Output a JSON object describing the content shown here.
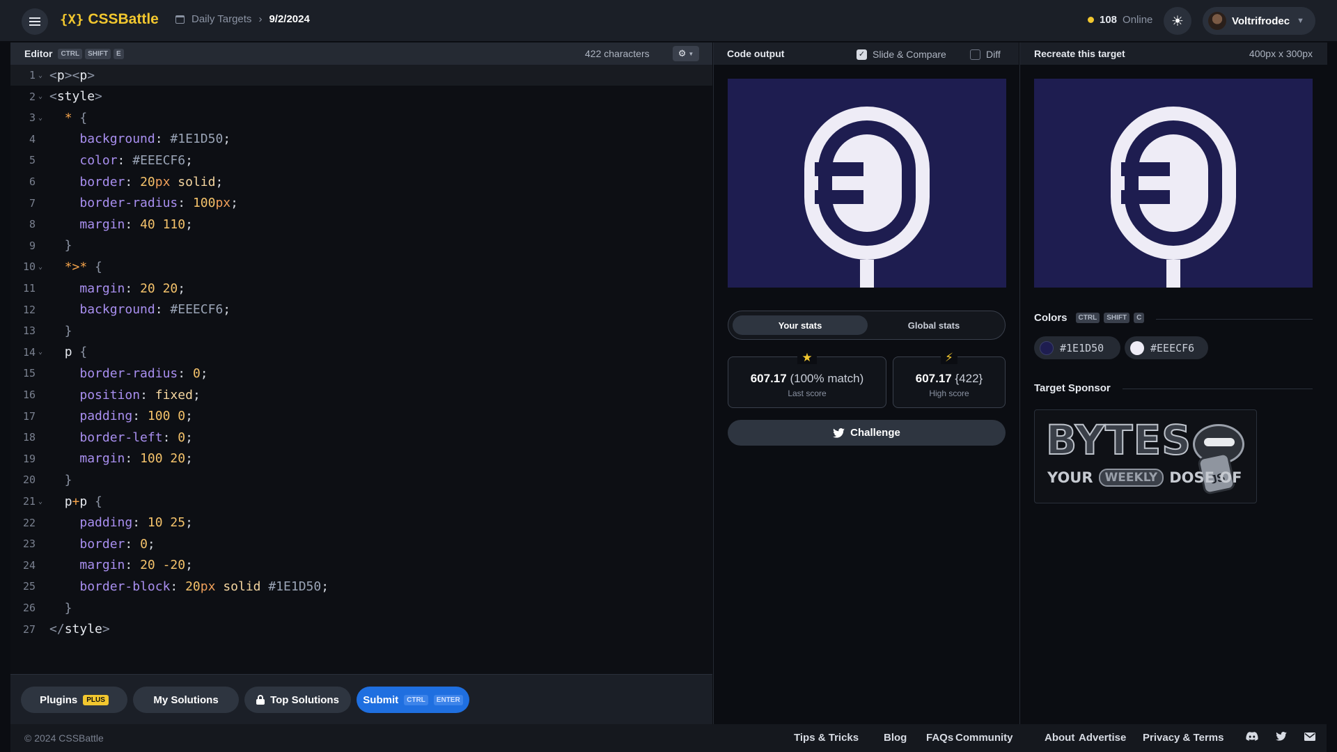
{
  "header": {
    "logo_mark": "{X}",
    "logo_text": "CSSBattle",
    "breadcrumb": {
      "section": "Daily Targets",
      "current": "9/2/2024"
    },
    "online_count": "108",
    "online_label": "Online",
    "username": "Voltrifrodec"
  },
  "editor": {
    "title": "Editor",
    "shortcut": [
      "CTRL",
      "SHIFT",
      "E"
    ],
    "char_count": "422 characters",
    "lines": [
      {
        "n": "1",
        "fold": true,
        "tokens": [
          [
            "t-tag",
            "<"
          ],
          [
            "t-name",
            "p"
          ],
          [
            "t-tag",
            "><"
          ],
          [
            "t-name",
            "p"
          ],
          [
            "t-tag",
            ">"
          ]
        ]
      },
      {
        "n": "2",
        "fold": true,
        "tokens": [
          [
            "t-tag",
            "<"
          ],
          [
            "t-name",
            "style"
          ],
          [
            "t-tag",
            ">"
          ]
        ]
      },
      {
        "n": "3",
        "fold": true,
        "tokens": [
          [
            "t-pl",
            "  "
          ],
          [
            "t-sel",
            "*"
          ],
          [
            "t-brace",
            " {"
          ]
        ]
      },
      {
        "n": "4",
        "fold": false,
        "tokens": [
          [
            "t-pl",
            "    "
          ],
          [
            "t-prop",
            "background"
          ],
          [
            "t-pl",
            ": "
          ],
          [
            "t-hex",
            "#1E1D50"
          ],
          [
            "t-pl",
            ";"
          ]
        ]
      },
      {
        "n": "5",
        "fold": false,
        "tokens": [
          [
            "t-pl",
            "    "
          ],
          [
            "t-prop",
            "color"
          ],
          [
            "t-pl",
            ": "
          ],
          [
            "t-hex",
            "#EEECF6"
          ],
          [
            "t-pl",
            ";"
          ]
        ]
      },
      {
        "n": "6",
        "fold": false,
        "tokens": [
          [
            "t-pl",
            "    "
          ],
          [
            "t-prop",
            "border"
          ],
          [
            "t-pl",
            ": "
          ],
          [
            "t-num",
            "20"
          ],
          [
            "t-unit",
            "px"
          ],
          [
            "t-pl",
            " "
          ],
          [
            "t-kw",
            "solid"
          ],
          [
            "t-pl",
            ";"
          ]
        ]
      },
      {
        "n": "7",
        "fold": false,
        "tokens": [
          [
            "t-pl",
            "    "
          ],
          [
            "t-prop",
            "border-radius"
          ],
          [
            "t-pl",
            ": "
          ],
          [
            "t-num",
            "100"
          ],
          [
            "t-unit",
            "px"
          ],
          [
            "t-pl",
            ";"
          ]
        ]
      },
      {
        "n": "8",
        "fold": false,
        "tokens": [
          [
            "t-pl",
            "    "
          ],
          [
            "t-prop",
            "margin"
          ],
          [
            "t-pl",
            ": "
          ],
          [
            "t-num",
            "40 110"
          ],
          [
            "t-pl",
            ";"
          ]
        ]
      },
      {
        "n": "9",
        "fold": false,
        "tokens": [
          [
            "t-brace",
            "  }"
          ]
        ]
      },
      {
        "n": "10",
        "fold": true,
        "tokens": [
          [
            "t-pl",
            "  "
          ],
          [
            "t-sel",
            "*>*"
          ],
          [
            "t-brace",
            " {"
          ]
        ]
      },
      {
        "n": "11",
        "fold": false,
        "tokens": [
          [
            "t-pl",
            "    "
          ],
          [
            "t-prop",
            "margin"
          ],
          [
            "t-pl",
            ": "
          ],
          [
            "t-num",
            "20 20"
          ],
          [
            "t-pl",
            ";"
          ]
        ]
      },
      {
        "n": "12",
        "fold": false,
        "tokens": [
          [
            "t-pl",
            "    "
          ],
          [
            "t-prop",
            "background"
          ],
          [
            "t-pl",
            ": "
          ],
          [
            "t-hex",
            "#EEECF6"
          ],
          [
            "t-pl",
            ";"
          ]
        ]
      },
      {
        "n": "13",
        "fold": false,
        "tokens": [
          [
            "t-brace",
            "  }"
          ]
        ]
      },
      {
        "n": "14",
        "fold": true,
        "tokens": [
          [
            "t-pl",
            "  "
          ],
          [
            "t-name",
            "p"
          ],
          [
            "t-brace",
            " {"
          ]
        ]
      },
      {
        "n": "15",
        "fold": false,
        "tokens": [
          [
            "t-pl",
            "    "
          ],
          [
            "t-prop",
            "border-radius"
          ],
          [
            "t-pl",
            ": "
          ],
          [
            "t-num",
            "0"
          ],
          [
            "t-pl",
            ";"
          ]
        ]
      },
      {
        "n": "16",
        "fold": false,
        "tokens": [
          [
            "t-pl",
            "    "
          ],
          [
            "t-prop",
            "position"
          ],
          [
            "t-pl",
            ": "
          ],
          [
            "t-kw",
            "fixed"
          ],
          [
            "t-pl",
            ";"
          ]
        ]
      },
      {
        "n": "17",
        "fold": false,
        "tokens": [
          [
            "t-pl",
            "    "
          ],
          [
            "t-prop",
            "padding"
          ],
          [
            "t-pl",
            ": "
          ],
          [
            "t-num",
            "100 0"
          ],
          [
            "t-pl",
            ";"
          ]
        ]
      },
      {
        "n": "18",
        "fold": false,
        "tokens": [
          [
            "t-pl",
            "    "
          ],
          [
            "t-prop",
            "border-left"
          ],
          [
            "t-pl",
            ": "
          ],
          [
            "t-num",
            "0"
          ],
          [
            "t-pl",
            ";"
          ]
        ]
      },
      {
        "n": "19",
        "fold": false,
        "tokens": [
          [
            "t-pl",
            "    "
          ],
          [
            "t-prop",
            "margin"
          ],
          [
            "t-pl",
            ": "
          ],
          [
            "t-num",
            "100 20"
          ],
          [
            "t-pl",
            ";"
          ]
        ]
      },
      {
        "n": "20",
        "fold": false,
        "tokens": [
          [
            "t-brace",
            "  }"
          ]
        ]
      },
      {
        "n": "21",
        "fold": true,
        "tokens": [
          [
            "t-pl",
            "  "
          ],
          [
            "t-name",
            "p"
          ],
          [
            "t-sel",
            "+"
          ],
          [
            "t-name",
            "p"
          ],
          [
            "t-brace",
            " {"
          ]
        ]
      },
      {
        "n": "22",
        "fold": false,
        "tokens": [
          [
            "t-pl",
            "    "
          ],
          [
            "t-prop",
            "padding"
          ],
          [
            "t-pl",
            ": "
          ],
          [
            "t-num",
            "10 25"
          ],
          [
            "t-pl",
            ";"
          ]
        ]
      },
      {
        "n": "23",
        "fold": false,
        "tokens": [
          [
            "t-pl",
            "    "
          ],
          [
            "t-prop",
            "border"
          ],
          [
            "t-pl",
            ": "
          ],
          [
            "t-num",
            "0"
          ],
          [
            "t-pl",
            ";"
          ]
        ]
      },
      {
        "n": "24",
        "fold": false,
        "tokens": [
          [
            "t-pl",
            "    "
          ],
          [
            "t-prop",
            "margin"
          ],
          [
            "t-pl",
            ": "
          ],
          [
            "t-num",
            "20 -20"
          ],
          [
            "t-pl",
            ";"
          ]
        ]
      },
      {
        "n": "25",
        "fold": false,
        "tokens": [
          [
            "t-pl",
            "    "
          ],
          [
            "t-prop",
            "border-block"
          ],
          [
            "t-pl",
            ": "
          ],
          [
            "t-num",
            "20"
          ],
          [
            "t-unit",
            "px"
          ],
          [
            "t-pl",
            " "
          ],
          [
            "t-kw",
            "solid"
          ],
          [
            "t-pl",
            " "
          ],
          [
            "t-hex",
            "#1E1D50"
          ],
          [
            "t-pl",
            ";"
          ]
        ]
      },
      {
        "n": "26",
        "fold": false,
        "tokens": [
          [
            "t-brace",
            "  }"
          ]
        ]
      },
      {
        "n": "27",
        "fold": false,
        "tokens": [
          [
            "t-tag",
            "</"
          ],
          [
            "t-name",
            "style"
          ],
          [
            "t-tag",
            ">"
          ]
        ]
      }
    ],
    "active_line": "1",
    "footer_buttons": {
      "plugins": "Plugins",
      "plugins_badge": "PLUS",
      "my_solutions": "My Solutions",
      "top_solutions": "Top Solutions",
      "submit": "Submit",
      "submit_shortcut": [
        "CTRL",
        "ENTER"
      ]
    }
  },
  "output": {
    "title": "Code output",
    "slide_compare_label": "Slide & Compare",
    "slide_compare_checked": true,
    "diff_label": "Diff",
    "diff_checked": false,
    "tabs": [
      "Your stats",
      "Global stats"
    ],
    "active_tab": "Your stats",
    "last_score": {
      "value": "607.17",
      "detail": "(100% match)",
      "label": "Last score"
    },
    "high_score": {
      "value": "607.17",
      "detail": "{422}",
      "label": "High score"
    },
    "challenge_label": "Challenge"
  },
  "target": {
    "title": "Recreate this target",
    "size": "400px x 300px",
    "colors_title": "Colors",
    "colors_shortcut": [
      "CTRL",
      "SHIFT",
      "C"
    ],
    "colors": [
      {
        "hex": "#1E1D50"
      },
      {
        "hex": "#EEECF6"
      }
    ],
    "sponsor_title": "Target Sponsor",
    "sponsor_logo_text": "BYTES",
    "sponsor_tagline": {
      "before": "YOUR",
      "highlight": "WEEKLY",
      "after": "DOSE OF",
      "badge": "JS"
    }
  },
  "footer": {
    "copyright": "© 2024 CSSBattle",
    "links": [
      "Tips & Tricks",
      "Blog",
      "FAQs",
      "Community",
      "About",
      "Advertise",
      "Privacy & Terms"
    ],
    "icons": [
      "discord-icon",
      "twitter-icon",
      "mail-icon"
    ]
  },
  "colors": {
    "brand": "#f2c72f",
    "submit_blue": "#1f6fe0",
    "target_bg": "#1E1D50",
    "target_fg": "#EEECF6"
  }
}
